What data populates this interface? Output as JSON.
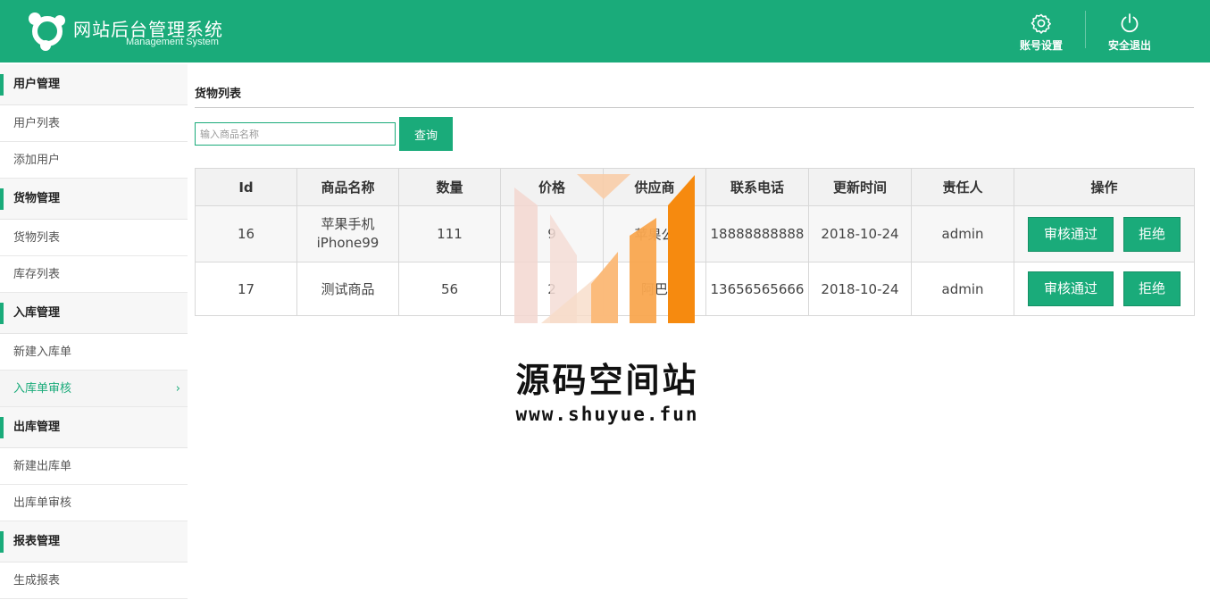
{
  "header": {
    "title": "网站后台管理系统",
    "subtitle": "Management System",
    "actions": {
      "settings": {
        "label": "账号设置",
        "icon": "gear-icon"
      },
      "logout": {
        "label": "安全退出",
        "icon": "power-icon"
      }
    }
  },
  "sidebar": {
    "groups": [
      {
        "title": "用户管理",
        "items": [
          "用户列表",
          "添加用户"
        ]
      },
      {
        "title": "货物管理",
        "items": [
          "货物列表",
          "库存列表"
        ]
      },
      {
        "title": "入库管理",
        "items": [
          "新建入库单",
          "入库单审核"
        ]
      },
      {
        "title": "出库管理",
        "items": [
          "新建出库单",
          "出库单审核"
        ]
      },
      {
        "title": "报表管理",
        "items": [
          "生成报表"
        ]
      }
    ],
    "active_item": "入库单审核"
  },
  "main": {
    "section_title": "货物列表",
    "search": {
      "placeholder": "输入商品名称",
      "value": "",
      "button": "查询"
    },
    "table": {
      "columns": [
        "Id",
        "商品名称",
        "数量",
        "价格",
        "供应商",
        "联系电话",
        "更新时间",
        "责任人",
        "操作"
      ],
      "rows": [
        {
          "id": "16",
          "name": "苹果手机iPhone99",
          "qty": "111",
          "price": "9",
          "supplier": "苹果公",
          "phone": "18888888888",
          "updated": "2018-10-24",
          "owner": "admin"
        },
        {
          "id": "17",
          "name": "测试商品",
          "qty": "56",
          "price": "2",
          "supplier": "阿巴",
          "phone": "13656565666",
          "updated": "2018-10-24",
          "owner": "admin"
        }
      ],
      "actions": {
        "approve": "审核通过",
        "reject": "拒绝"
      }
    }
  },
  "watermark": {
    "title": "源码空间站",
    "url": "www.shuyue.fun"
  },
  "colors": {
    "brand": "#1aab7a",
    "header_bg": "#1aab7a"
  }
}
